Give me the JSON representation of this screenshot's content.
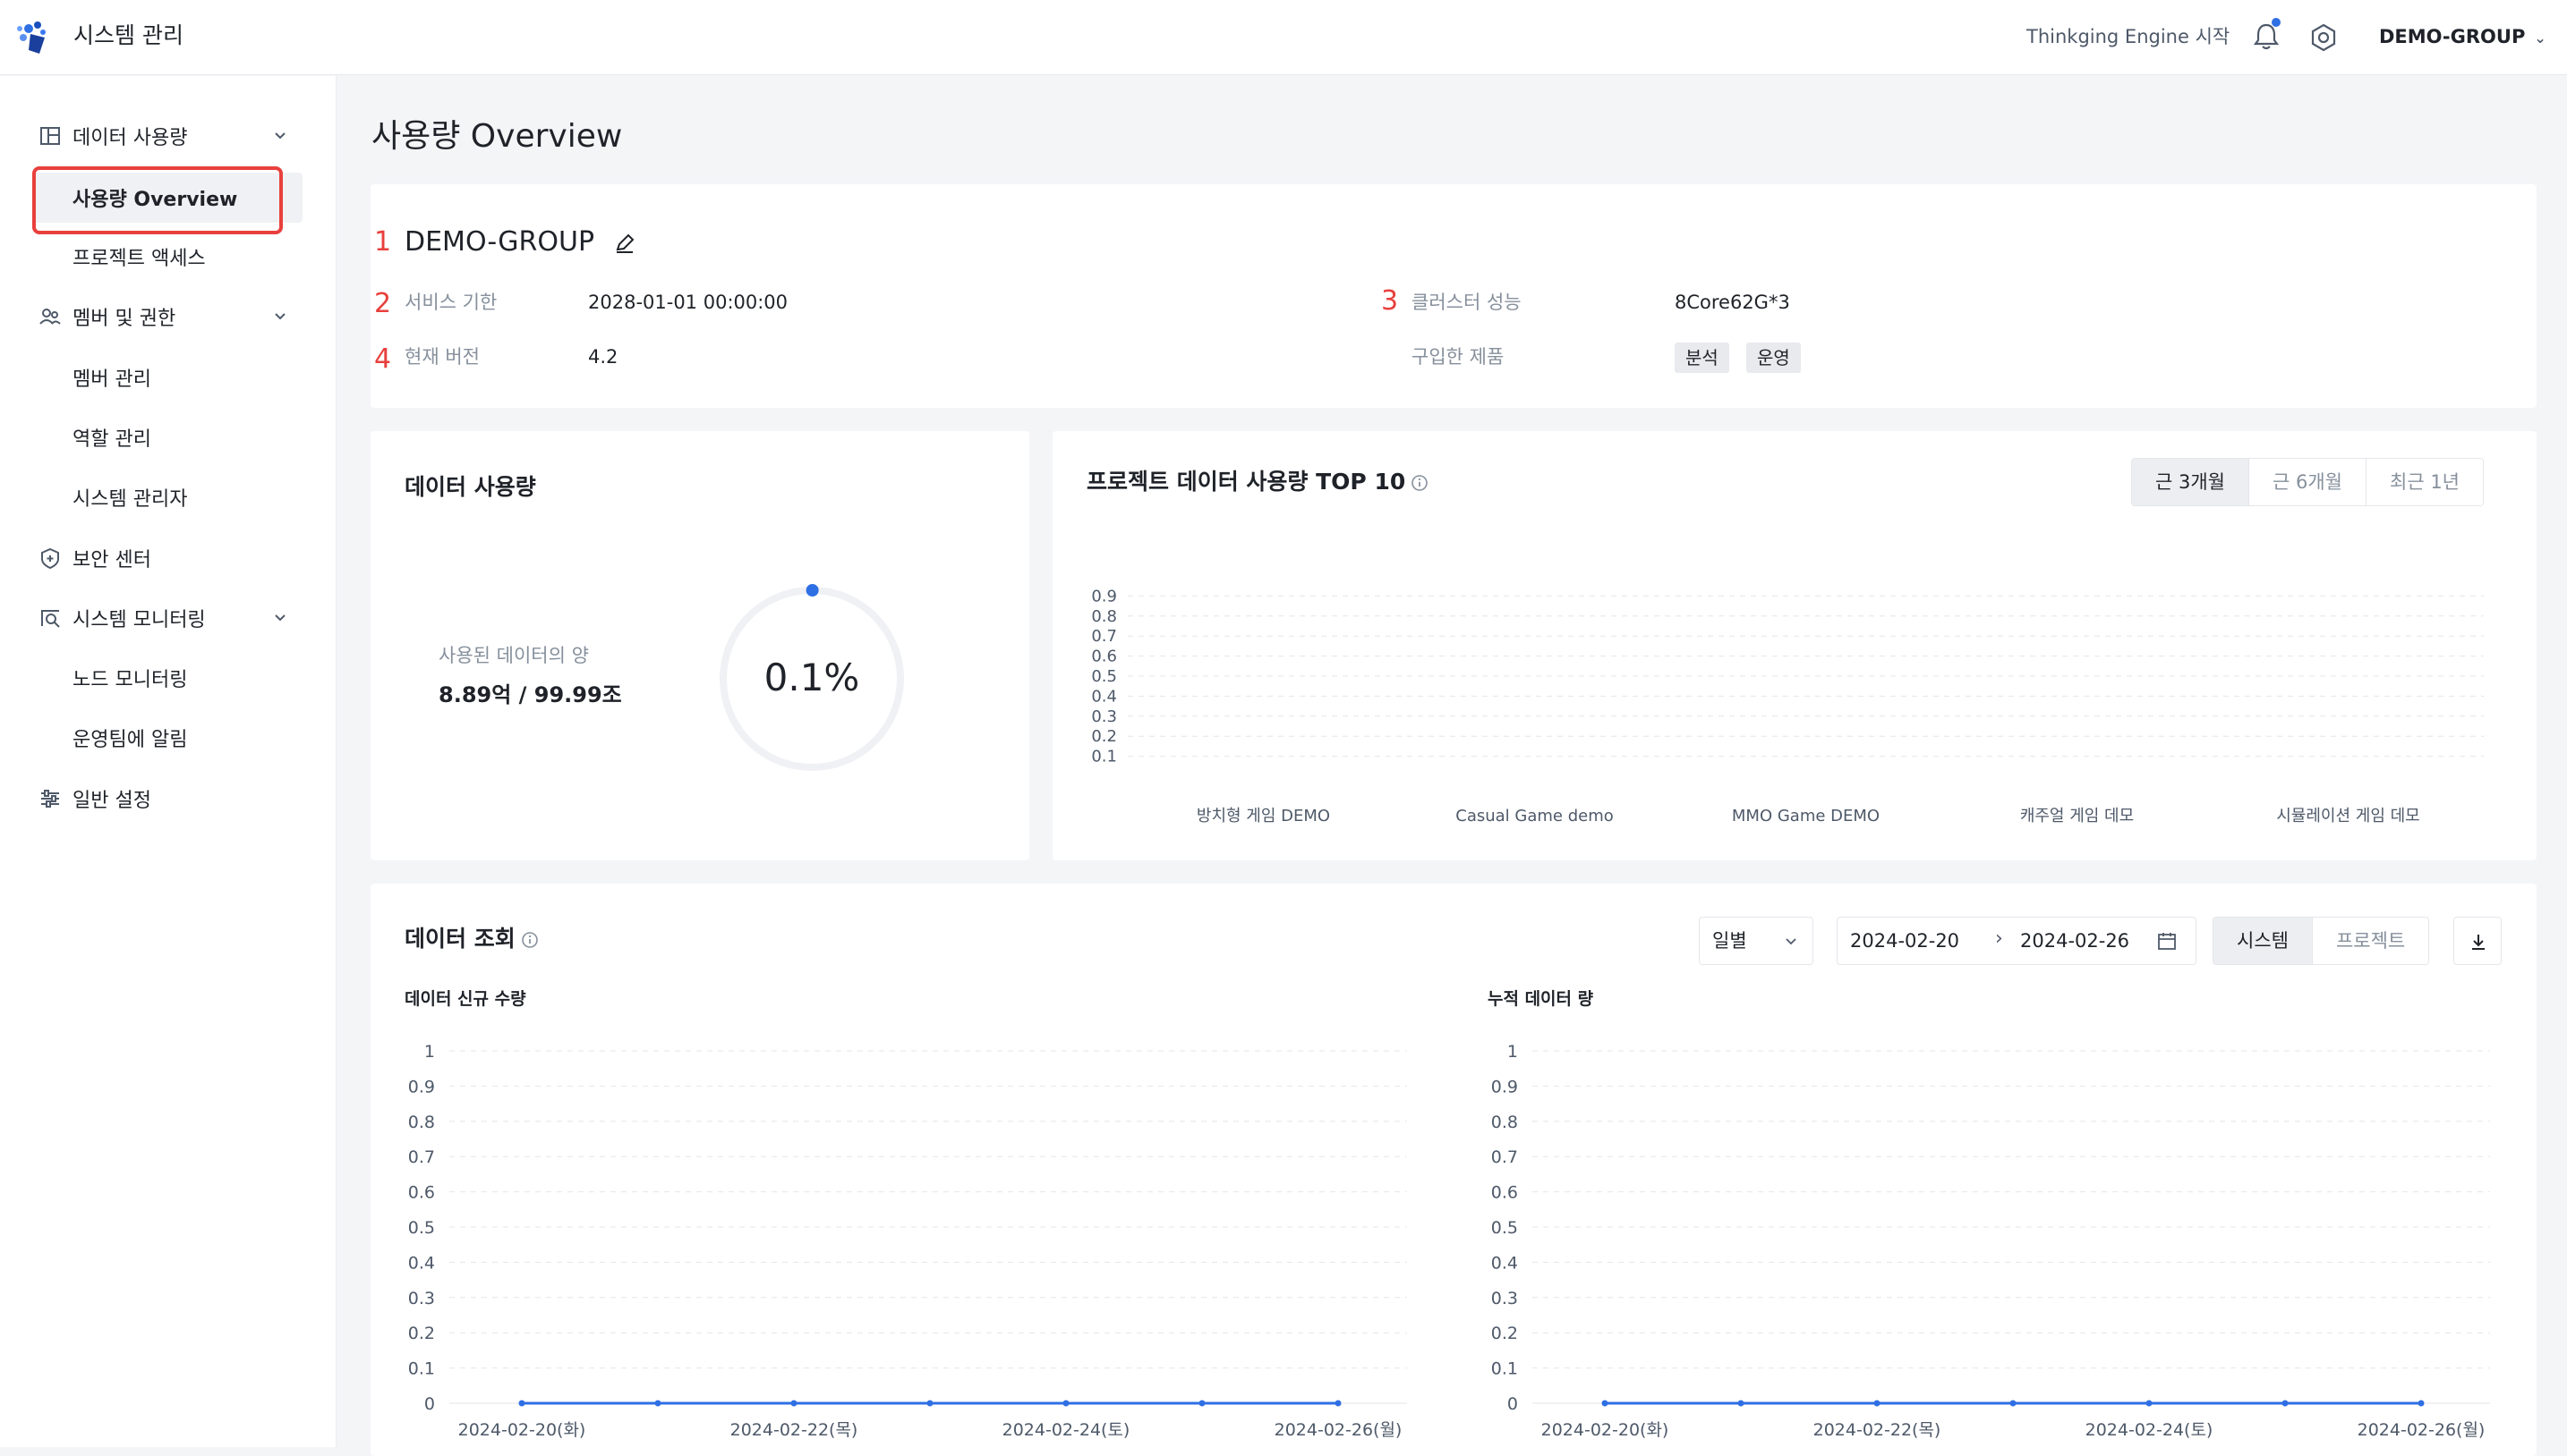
{
  "header": {
    "app_title": "시스템 관리",
    "engine_link": "Thinkging Engine 시작",
    "group_select": "DEMO-GROUP",
    "icons": [
      "logo-icon",
      "bell-icon",
      "gear-icon",
      "chevron-down-icon"
    ]
  },
  "sidebar": {
    "items": [
      {
        "label": "데이터 사용량",
        "icon": "database-icon",
        "expandable": true
      },
      {
        "label": "사용량 Overview",
        "sub": true,
        "active": true
      },
      {
        "label": "프로젝트 액세스",
        "sub": true
      },
      {
        "label": "멤버 및 권한",
        "icon": "members-icon",
        "expandable": true
      },
      {
        "label": "멤버 관리",
        "sub": true
      },
      {
        "label": "역할 관리",
        "sub": true
      },
      {
        "label": "시스템 관리자",
        "sub": true
      },
      {
        "label": "보안 센터",
        "icon": "shield-icon"
      },
      {
        "label": "시스템 모니터링",
        "icon": "monitor-icon",
        "expandable": true
      },
      {
        "label": "노드 모니터링",
        "sub": true
      },
      {
        "label": "운영팀에 알림",
        "sub": true
      },
      {
        "label": "일반 설정",
        "icon": "sliders-icon"
      }
    ]
  },
  "page_title": "사용량 Overview",
  "group_card": {
    "marker_1": "1",
    "name": "DEMO-GROUP",
    "marker_2": "2",
    "service_label": "서비스 기한",
    "service_value": "2028-01-01 00:00:00",
    "marker_3": "3",
    "cluster_label": "클러스터 성능",
    "cluster_value": "8Core62G*3",
    "marker_4": "4",
    "version_label": "현재 버전",
    "version_value": "4.2",
    "products_label": "구입한 제품",
    "products": [
      "분석",
      "운영"
    ]
  },
  "usage_card": {
    "title": "데이터 사용량",
    "used_label": "사용된 데이터의 양",
    "used_value": "8.89억 / 99.99조",
    "percent_text": "0.1%",
    "percent": 0.1
  },
  "top10_card": {
    "title": "프로젝트 데이터 사용량 TOP 10",
    "ranges": [
      "근 3개월",
      "근 6개월",
      "최근 1년"
    ],
    "active_range": "근 3개월"
  },
  "query_card": {
    "title": "데이터 조회",
    "granularity": "일별",
    "date_start": "2024-02-20",
    "date_end": "2024-02-26",
    "date_separator": "›",
    "scope": [
      "시스템",
      "프로젝트"
    ],
    "active_scope": "시스템",
    "left_chart_title": "데이터 신규 수량",
    "right_chart_title": "누적 데이터 량"
  },
  "chart_data": [
    {
      "type": "bar",
      "title": "프로젝트 데이터 사용량 TOP 10",
      "categories": [
        "방치형 게임 DEMO",
        "Casual Game demo",
        "MMO Game DEMO",
        "캐주얼 게임 데모",
        "시뮬레이션 게임 데모"
      ],
      "values": [
        0,
        0,
        0,
        0,
        0
      ],
      "yticks": [
        "0.9",
        "0.8",
        "0.7",
        "0.6",
        "0.5",
        "0.4",
        "0.3",
        "0.2",
        "0.1"
      ],
      "ylim": [
        0,
        1
      ],
      "grid": true
    },
    {
      "type": "line",
      "title": "데이터 신규 수량",
      "x": [
        "2024-02-20",
        "2024-02-21",
        "2024-02-22",
        "2024-02-23",
        "2024-02-24",
        "2024-02-25",
        "2024-02-26"
      ],
      "xticks": [
        "2024-02-20(화)",
        "2024-02-22(목)",
        "2024-02-24(토)",
        "2024-02-26(월)"
      ],
      "values": [
        0,
        0,
        0,
        0,
        0,
        0,
        0
      ],
      "yticks": [
        "1",
        "0.9",
        "0.8",
        "0.7",
        "0.6",
        "0.5",
        "0.4",
        "0.3",
        "0.2",
        "0.1",
        "0"
      ],
      "ylim": [
        0,
        1
      ],
      "grid": true
    },
    {
      "type": "line",
      "title": "누적 데이터 량",
      "x": [
        "2024-02-20",
        "2024-02-21",
        "2024-02-22",
        "2024-02-23",
        "2024-02-24",
        "2024-02-25",
        "2024-02-26"
      ],
      "xticks": [
        "2024-02-20(화)",
        "2024-02-22(목)",
        "2024-02-24(토)",
        "2024-02-26(월)"
      ],
      "values": [
        0,
        0,
        0,
        0,
        0,
        0,
        0
      ],
      "yticks": [
        "1",
        "0.9",
        "0.8",
        "0.7",
        "0.6",
        "0.5",
        "0.4",
        "0.3",
        "0.2",
        "0.1",
        "0"
      ],
      "ylim": [
        0,
        1
      ],
      "grid": true
    }
  ],
  "colors": {
    "accent": "#2f6fe4",
    "highlight": "#e8403d",
    "grid": "#e5e6eb"
  }
}
